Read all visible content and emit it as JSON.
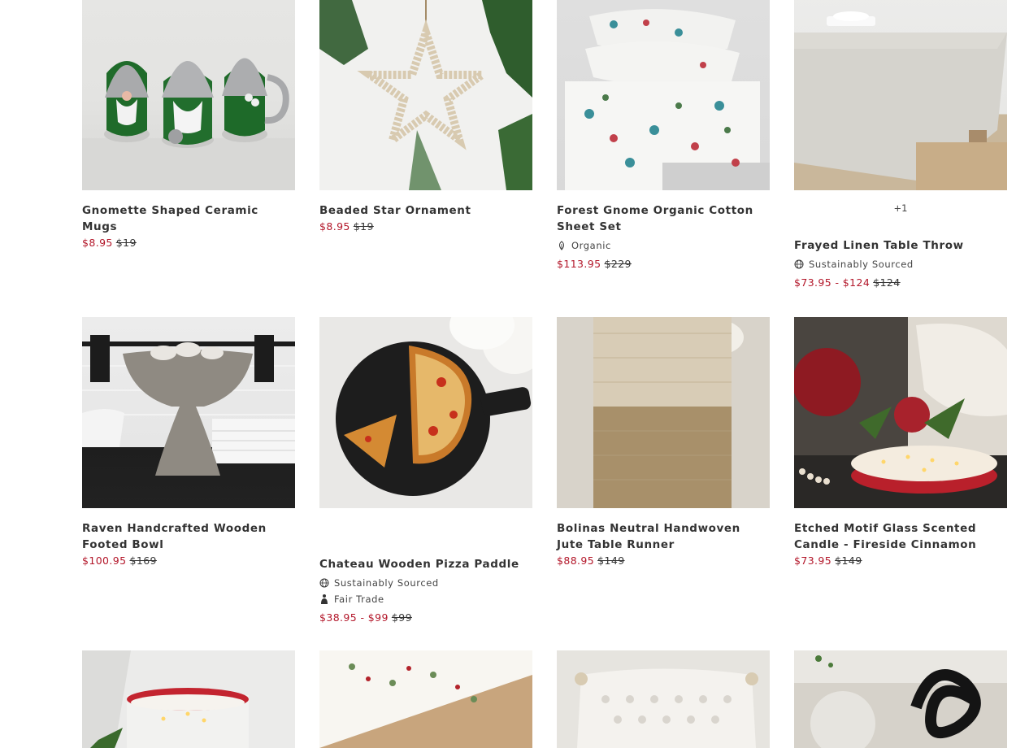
{
  "products": [
    {
      "title": "Gnomette Shaped Ceramic Mugs",
      "price_sale": "$8.95",
      "price_original": "$19",
      "attributes": [],
      "image": "gnome-mugs-image"
    },
    {
      "title": "Beaded Star Ornament",
      "price_sale": "$8.95",
      "price_original": "$19",
      "attributes": [],
      "image": "star-ornament-image"
    },
    {
      "title": "Forest Gnome Organic Cotton Sheet Set",
      "price_sale": "$113.95",
      "price_original": "$229",
      "attributes": [
        {
          "icon": "organic-leaf-icon",
          "label": "Organic"
        }
      ],
      "image": "sheet-set-image"
    },
    {
      "title": "Frayed Linen Table Throw",
      "swatch_more": "+1",
      "price_sale": "$73.95 - $124",
      "price_original": "$124",
      "attributes": [
        {
          "icon": "globe-icon",
          "label": "Sustainably Sourced"
        }
      ],
      "image": "table-throw-image"
    },
    {
      "title": "Raven Handcrafted Wooden Footed Bowl",
      "price_sale": "$100.95",
      "price_original": "$169",
      "attributes": [],
      "image": "footed-bowl-image"
    },
    {
      "title": "Chateau Wooden Pizza Paddle",
      "price_sale": "$38.95 - $99",
      "price_original": "$99",
      "attributes": [
        {
          "icon": "globe-icon",
          "label": "Sustainably Sourced"
        },
        {
          "icon": "fair-trade-icon",
          "label": "Fair Trade"
        }
      ],
      "image": "pizza-paddle-image"
    },
    {
      "title": "Bolinas Neutral Handwoven Jute Table Runner",
      "price_sale": "$88.95",
      "price_original": "$149",
      "attributes": [],
      "image": "jute-runner-image"
    },
    {
      "title": "Etched Motif Glass Scented Candle - Fireside Cinnamon",
      "price_sale": "$73.95",
      "price_original": "$149",
      "attributes": [],
      "image": "scented-candle-image"
    }
  ],
  "colors": {
    "sale_price": "#b3172a",
    "text": "#333333"
  }
}
